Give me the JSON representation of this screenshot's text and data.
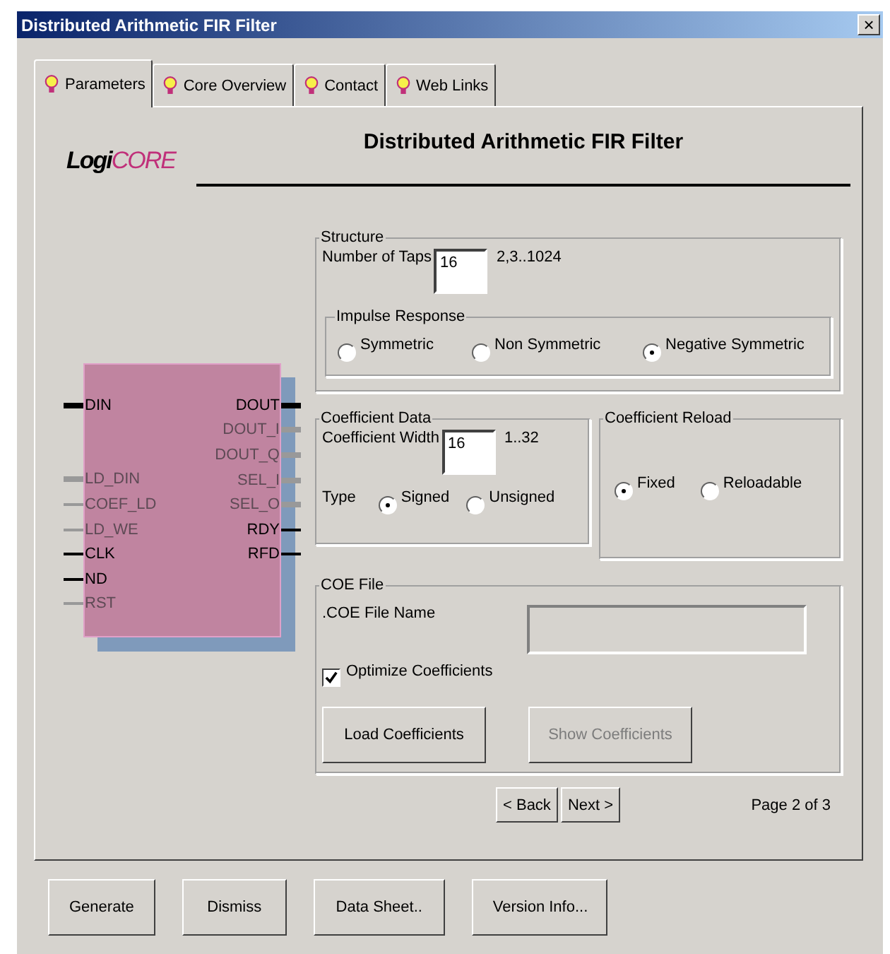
{
  "window": {
    "title": "Distributed Arithmetic FIR Filter",
    "close": "×"
  },
  "tabs": [
    {
      "label": "Parameters",
      "selected": true
    },
    {
      "label": "Core Overview",
      "selected": false
    },
    {
      "label": "Contact",
      "selected": false
    },
    {
      "label": "Web Links",
      "selected": false
    }
  ],
  "logo": {
    "part_1": "Logi",
    "part_2": "CORE"
  },
  "heading": "Distributed Arithmetic FIR Filter",
  "symbol": {
    "left_pin_groups": [
      {
        "pins": [
          {
            "label": "DIN",
            "enabled": true,
            "bus": true
          }
        ]
      },
      {
        "pins": [
          {
            "label": "LD_DIN",
            "enabled": false,
            "bus": true
          },
          {
            "label": "COEF_LD",
            "enabled": false,
            "bus": false
          },
          {
            "label": "LD_WE",
            "enabled": false,
            "bus": false
          },
          {
            "label": "CLK",
            "enabled": true,
            "bus": false
          },
          {
            "label": "ND",
            "enabled": true,
            "bus": false
          },
          {
            "label": "RST",
            "enabled": false,
            "bus": false
          }
        ]
      }
    ],
    "right_pins": [
      {
        "label": "DOUT",
        "enabled": true,
        "bus": true
      },
      {
        "label": "DOUT_I",
        "enabled": false,
        "bus": true
      },
      {
        "label": "DOUT_Q",
        "enabled": false,
        "bus": true
      },
      {
        "label": "SEL_I",
        "enabled": false,
        "bus": true
      },
      {
        "label": "SEL_O",
        "enabled": false,
        "bus": true
      },
      {
        "label": "RDY",
        "enabled": true,
        "bus": false
      },
      {
        "label": "RFD",
        "enabled": true,
        "bus": false
      }
    ]
  },
  "structure": {
    "legend": "Structure",
    "taps_label": "Number of Taps",
    "taps_value": "16",
    "taps_range": "2,3..1024",
    "impulse_legend": "Impulse Response",
    "impulse_options": [
      {
        "label": "Symmetric",
        "selected": false
      },
      {
        "label": "Non Symmetric",
        "selected": false
      },
      {
        "label": "Negative Symmetric",
        "selected": true
      }
    ]
  },
  "coefficient_data": {
    "legend": "Coefficient Data",
    "width_label": "Coefficient Width",
    "width_value": "16",
    "width_range": "1..32",
    "type_label": "Type",
    "type_options": [
      {
        "label": "Signed",
        "selected": true
      },
      {
        "label": "Unsigned",
        "selected": false
      }
    ]
  },
  "coefficient_reload": {
    "legend": "Coefficient Reload",
    "options": [
      {
        "label": "Fixed",
        "selected": true
      },
      {
        "label": "Reloadable",
        "selected": false
      }
    ]
  },
  "coe_file": {
    "legend": "COE File",
    "name_label": ".COE File Name",
    "optimize": {
      "label": "Optimize Coefficients",
      "checked": true
    },
    "buttons": [
      {
        "label": "Load Coefficients",
        "disabled": false
      },
      {
        "label": "Show Coefficients",
        "disabled": true
      }
    ]
  },
  "nav": {
    "back": "< Back",
    "next": "Next >",
    "page": "Page 2 of 3"
  },
  "buttons": [
    "Generate",
    "Dismiss",
    "Data Sheet..",
    "Version Info..."
  ]
}
